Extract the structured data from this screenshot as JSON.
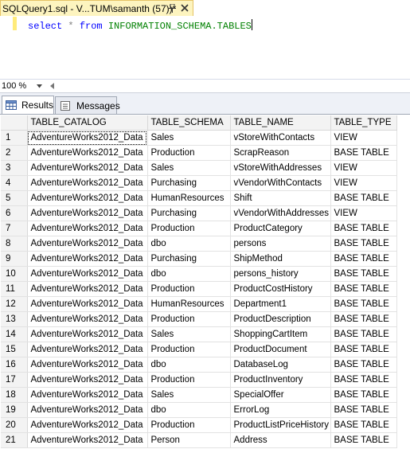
{
  "tab": {
    "title": "SQLQuery1.sql - V...TUM\\samanth (57))*"
  },
  "editor": {
    "keyword_select": "select",
    "operator_star": "*",
    "keyword_from": "from",
    "object_name": "INFORMATION_SCHEMA.TABLES"
  },
  "zoom": {
    "value": "100 %"
  },
  "result_tabs": {
    "results_label": "Results",
    "messages_label": "Messages"
  },
  "grid": {
    "columns": [
      "TABLE_CATALOG",
      "TABLE_SCHEMA",
      "TABLE_NAME",
      "TABLE_TYPE"
    ],
    "rows": [
      {
        "n": "1",
        "catalog": "AdventureWorks2012_Data",
        "schema": "Sales",
        "name": "vStoreWithContacts",
        "type": "VIEW"
      },
      {
        "n": "2",
        "catalog": "AdventureWorks2012_Data",
        "schema": "Production",
        "name": "ScrapReason",
        "type": "BASE TABLE"
      },
      {
        "n": "3",
        "catalog": "AdventureWorks2012_Data",
        "schema": "Sales",
        "name": "vStoreWithAddresses",
        "type": "VIEW"
      },
      {
        "n": "4",
        "catalog": "AdventureWorks2012_Data",
        "schema": "Purchasing",
        "name": "vVendorWithContacts",
        "type": "VIEW"
      },
      {
        "n": "5",
        "catalog": "AdventureWorks2012_Data",
        "schema": "HumanResources",
        "name": "Shift",
        "type": "BASE TABLE"
      },
      {
        "n": "6",
        "catalog": "AdventureWorks2012_Data",
        "schema": "Purchasing",
        "name": "vVendorWithAddresses",
        "type": "VIEW"
      },
      {
        "n": "7",
        "catalog": "AdventureWorks2012_Data",
        "schema": "Production",
        "name": "ProductCategory",
        "type": "BASE TABLE"
      },
      {
        "n": "8",
        "catalog": "AdventureWorks2012_Data",
        "schema": "dbo",
        "name": "persons",
        "type": "BASE TABLE"
      },
      {
        "n": "9",
        "catalog": "AdventureWorks2012_Data",
        "schema": "Purchasing",
        "name": "ShipMethod",
        "type": "BASE TABLE"
      },
      {
        "n": "10",
        "catalog": "AdventureWorks2012_Data",
        "schema": "dbo",
        "name": "persons_history",
        "type": "BASE TABLE"
      },
      {
        "n": "11",
        "catalog": "AdventureWorks2012_Data",
        "schema": "Production",
        "name": "ProductCostHistory",
        "type": "BASE TABLE"
      },
      {
        "n": "12",
        "catalog": "AdventureWorks2012_Data",
        "schema": "HumanResources",
        "name": "Department1",
        "type": "BASE TABLE"
      },
      {
        "n": "13",
        "catalog": "AdventureWorks2012_Data",
        "schema": "Production",
        "name": "ProductDescription",
        "type": "BASE TABLE"
      },
      {
        "n": "14",
        "catalog": "AdventureWorks2012_Data",
        "schema": "Sales",
        "name": "ShoppingCartItem",
        "type": "BASE TABLE"
      },
      {
        "n": "15",
        "catalog": "AdventureWorks2012_Data",
        "schema": "Production",
        "name": "ProductDocument",
        "type": "BASE TABLE"
      },
      {
        "n": "16",
        "catalog": "AdventureWorks2012_Data",
        "schema": "dbo",
        "name": "DatabaseLog",
        "type": "BASE TABLE"
      },
      {
        "n": "17",
        "catalog": "AdventureWorks2012_Data",
        "schema": "Production",
        "name": "ProductInventory",
        "type": "BASE TABLE"
      },
      {
        "n": "18",
        "catalog": "AdventureWorks2012_Data",
        "schema": "Sales",
        "name": "SpecialOffer",
        "type": "BASE TABLE"
      },
      {
        "n": "19",
        "catalog": "AdventureWorks2012_Data",
        "schema": "dbo",
        "name": "ErrorLog",
        "type": "BASE TABLE"
      },
      {
        "n": "20",
        "catalog": "AdventureWorks2012_Data",
        "schema": "Production",
        "name": "ProductListPriceHistory",
        "type": "BASE TABLE"
      },
      {
        "n": "21",
        "catalog": "AdventureWorks2012_Data",
        "schema": "Person",
        "name": "Address",
        "type": "BASE TABLE"
      }
    ]
  },
  "icons": {
    "pin": "pin-icon",
    "close": "close-icon",
    "zoom_dropdown": "chevron-down-icon",
    "scroll_left": "chevron-left-icon",
    "results": "grid-icon",
    "messages": "message-icon"
  },
  "colors": {
    "keyword": "#0000ff",
    "operator": "#808080",
    "object": "#008000",
    "active_tab": "#fdf4bf",
    "change_bar": "#ffeb7a"
  }
}
